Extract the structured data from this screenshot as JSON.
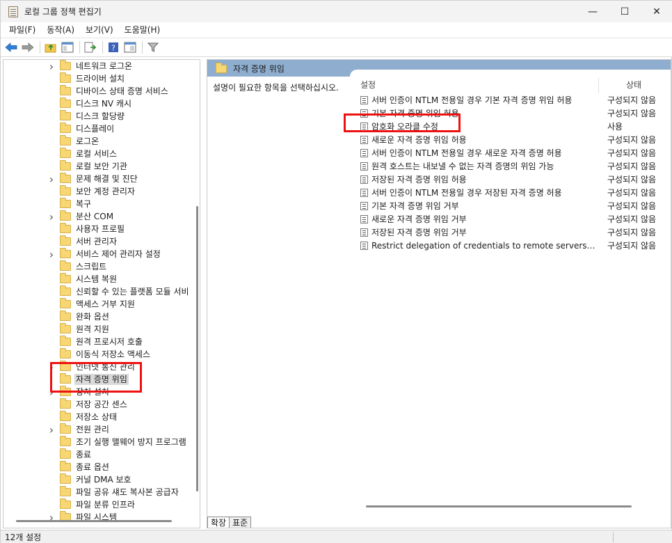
{
  "window": {
    "title": "로컬 그룹 정책 편집기",
    "minimize_glyph": "—",
    "maximize_glyph": "☐",
    "close_glyph": "✕"
  },
  "menu": [
    "파일(F)",
    "동작(A)",
    "보기(V)",
    "도움말(H)"
  ],
  "toolbar": {
    "icons": [
      "back-icon",
      "forward-icon",
      "up-folder-icon",
      "show-hide-tree-icon",
      "export-list-icon",
      "help-icon",
      "extended-view-icon",
      "filter-icon"
    ]
  },
  "tree": {
    "items": [
      {
        "label": "네트워크 로그온",
        "expandable": true
      },
      {
        "label": "드라이버 설치",
        "expandable": false
      },
      {
        "label": "디바이스 상태 증명 서비스",
        "expandable": false
      },
      {
        "label": "디스크 NV 캐시",
        "expandable": false
      },
      {
        "label": "디스크 할당량",
        "expandable": false
      },
      {
        "label": "디스플레이",
        "expandable": false
      },
      {
        "label": "로그온",
        "expandable": false
      },
      {
        "label": "로컬 서비스",
        "expandable": false
      },
      {
        "label": "로컬 보안 기관",
        "expandable": false
      },
      {
        "label": "문제 해결 및 진단",
        "expandable": true
      },
      {
        "label": "보안 계정 관리자",
        "expandable": false
      },
      {
        "label": "복구",
        "expandable": false
      },
      {
        "label": "분산 COM",
        "expandable": true
      },
      {
        "label": "사용자 프로필",
        "expandable": false
      },
      {
        "label": "서버 관리자",
        "expandable": false
      },
      {
        "label": "서비스 제어 관리자 설정",
        "expandable": true
      },
      {
        "label": "스크립트",
        "expandable": false
      },
      {
        "label": "시스템 복원",
        "expandable": false
      },
      {
        "label": "신뢰할 수 있는 플랫폼 모듈 서비",
        "expandable": false
      },
      {
        "label": "액세스 거부 지원",
        "expandable": false
      },
      {
        "label": "완화 옵션",
        "expandable": false
      },
      {
        "label": "원격 지원",
        "expandable": false
      },
      {
        "label": "원격 프로시저 호출",
        "expandable": false
      },
      {
        "label": "이동식 저장소 액세스",
        "expandable": false
      },
      {
        "label": "인터넷 통신 관리",
        "expandable": true
      },
      {
        "label": "자격 증명 위임",
        "expandable": false,
        "selected": true
      },
      {
        "label": "장치 설치",
        "expandable": true
      },
      {
        "label": "저장 공간 센스",
        "expandable": false
      },
      {
        "label": "저장소 상태",
        "expandable": false
      },
      {
        "label": "전원 관리",
        "expandable": true
      },
      {
        "label": "조기 실행 맬웨어 방지 프로그램",
        "expandable": false
      },
      {
        "label": "종료",
        "expandable": false
      },
      {
        "label": "종료 옵션",
        "expandable": false
      },
      {
        "label": "커널 DMA 보호",
        "expandable": false
      },
      {
        "label": "파일 공유 섀도 복사본 공급자",
        "expandable": false
      },
      {
        "label": "파일 분류 인프라",
        "expandable": false
      },
      {
        "label": "파일 시스템",
        "expandable": true
      }
    ]
  },
  "right": {
    "header_title": "자격 증명 위임",
    "description": "설명이 필요한 항목을 선택하십시오.",
    "col_setting": "설정",
    "col_state": "상태",
    "rows": [
      {
        "name": "서버 인증이 NTLM 전용일 경우 기본 자격 증명 위임 허용",
        "state": "구성되지 않음"
      },
      {
        "name": "기본 자격 증명 위임 허용",
        "state": "구성되지 않음"
      },
      {
        "name": "암호화 오라클 수정",
        "state": "사용"
      },
      {
        "name": "새로운 자격 증명 위임 허용",
        "state": "구성되지 않음"
      },
      {
        "name": "서버 인증이 NTLM 전용일 경우 새로운 자격 증명 허용",
        "state": "구성되지 않음"
      },
      {
        "name": "원격 호스트는 내보낼 수 없는 자격 증명의 위임 가능",
        "state": "구성되지 않음"
      },
      {
        "name": "저장된 자격 증명 위임 허용",
        "state": "구성되지 않음"
      },
      {
        "name": "서버 인증이 NTLM 전용일 경우 저장된 자격 증명 허용",
        "state": "구성되지 않음"
      },
      {
        "name": "기본 자격 증명 위임 거부",
        "state": "구성되지 않음"
      },
      {
        "name": "새로운 자격 증명 위임 거부",
        "state": "구성되지 않음"
      },
      {
        "name": "저장된 자격 증명 위임 거부",
        "state": "구성되지 않음"
      },
      {
        "name": "Restrict delegation of credentials to remote servers(원격 서...",
        "state": "구성되지 않음"
      }
    ],
    "tabs": [
      "확장",
      "표준"
    ]
  },
  "status": {
    "text": "12개 설정"
  },
  "colors": {
    "header_bar": "#8faecf",
    "annotation_red": "#ee1111",
    "folder_yellow": "#f7d774"
  }
}
